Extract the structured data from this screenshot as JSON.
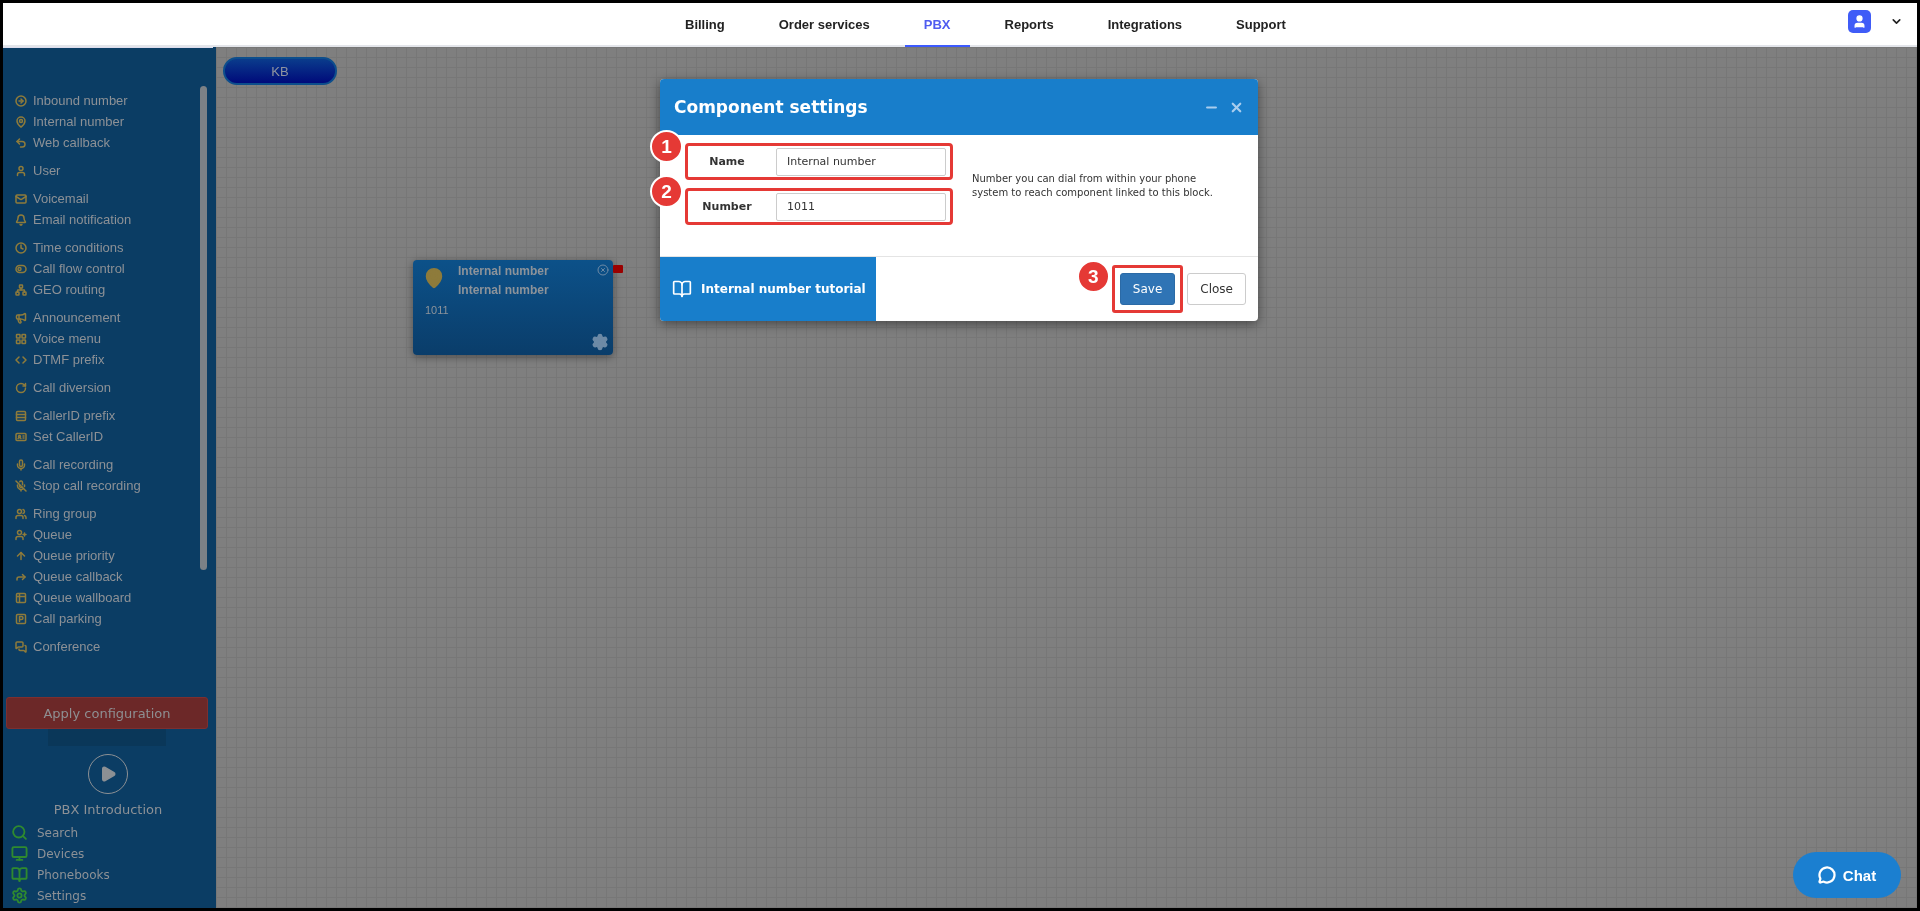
{
  "nav": {
    "tabs": [
      {
        "label": "Billing",
        "selected": false
      },
      {
        "label": "Order services",
        "selected": false
      },
      {
        "label": "PBX",
        "selected": true
      },
      {
        "label": "Reports",
        "selected": false
      },
      {
        "label": "Integrations",
        "selected": false
      },
      {
        "label": "Support",
        "selected": false
      }
    ]
  },
  "sidebar": {
    "groups": [
      {
        "items": [
          "Inbound number",
          "Internal number",
          "Web callback"
        ]
      },
      {
        "items": [
          "User"
        ]
      },
      {
        "items": [
          "Voicemail",
          "Email notification"
        ]
      },
      {
        "items": [
          "Time conditions",
          "Call flow control",
          "GEO routing"
        ]
      },
      {
        "items": [
          "Announcement",
          "Voice menu",
          "DTMF prefix"
        ]
      },
      {
        "items": [
          "Call diversion"
        ]
      },
      {
        "items": [
          "CallerID prefix",
          "Set CallerID"
        ]
      },
      {
        "items": [
          "Call recording",
          "Stop call recording"
        ]
      },
      {
        "items": [
          "Ring group",
          "Queue",
          "Queue priority",
          "Queue callback",
          "Queue wallboard",
          "Call parking"
        ]
      },
      {
        "items": [
          "Conference"
        ]
      }
    ],
    "apply_button": "Apply configuration",
    "intro": "PBX Introduction",
    "tools": [
      "Search",
      "Devices",
      "Phonebooks",
      "Settings"
    ]
  },
  "canvas": {
    "kb_button": "KB",
    "node": {
      "title": "Internal number",
      "subtitle": "Internal number",
      "number": "1011"
    }
  },
  "dialog": {
    "title": "Component settings",
    "fields": [
      {
        "label": "Name",
        "value": "Internal number",
        "marker": "1"
      },
      {
        "label": "Number",
        "value": "1011",
        "marker": "2"
      }
    ],
    "help": "Number you can dial from within your phone system to reach component linked to this block.",
    "tutorial": "Internal number tutorial",
    "buttons": [
      {
        "label": "Save",
        "kind": "primary",
        "marker": "3"
      },
      {
        "label": "Close",
        "kind": "default"
      }
    ]
  },
  "chat": {
    "label": "Chat"
  }
}
